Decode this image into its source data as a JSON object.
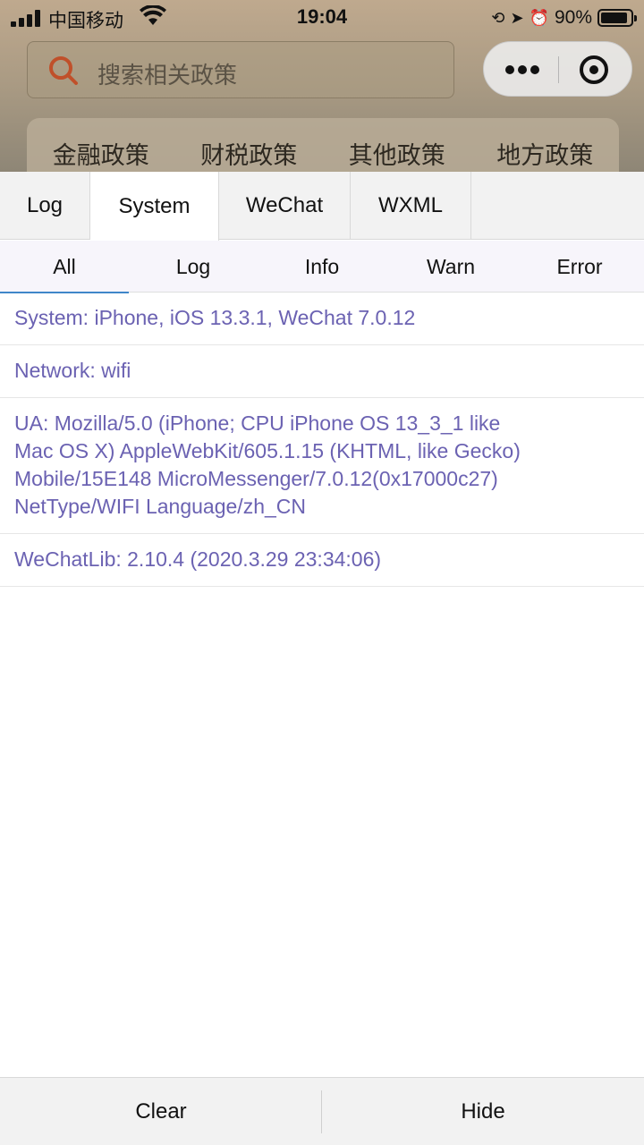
{
  "status_bar": {
    "carrier": "中国移动",
    "time": "19:04",
    "battery_percent": "90%",
    "battery_level": 0.9,
    "icons": [
      "signal-icon",
      "wifi-icon",
      "orientation-lock-icon",
      "location-arrow-icon",
      "alarm-icon",
      "battery-icon"
    ]
  },
  "background_app": {
    "search_placeholder": "搜索相关政策",
    "category_tabs": [
      "金融政策",
      "财税政策",
      "其他政策",
      "地方政策"
    ]
  },
  "console": {
    "main_tabs": [
      "Log",
      "System",
      "WeChat",
      "WXML"
    ],
    "active_main_tab": "System",
    "filter_tabs": [
      "All",
      "Log",
      "Info",
      "Warn",
      "Error"
    ],
    "active_filter_tab": "All",
    "entries": [
      "System: iPhone, iOS 13.3.1, WeChat 7.0.12",
      "Network: wifi",
      "UA: Mozilla/5.0 (iPhone; CPU iPhone OS 13_3_1 like Mac OS X) AppleWebKit/605.1.15 (KHTML, like Gecko) Mobile/15E148 MicroMessenger/7.0.12(0x17000c27) NetType/WIFI Language/zh_CN",
      "WeChatLib: 2.10.4 (2020.3.29 23:34:06)"
    ],
    "buttons": {
      "clear": "Clear",
      "hide": "Hide"
    }
  },
  "colors": {
    "log_text": "#6b62b2",
    "active_underline": "#3f86c9",
    "search_icon": "#c0502a"
  }
}
